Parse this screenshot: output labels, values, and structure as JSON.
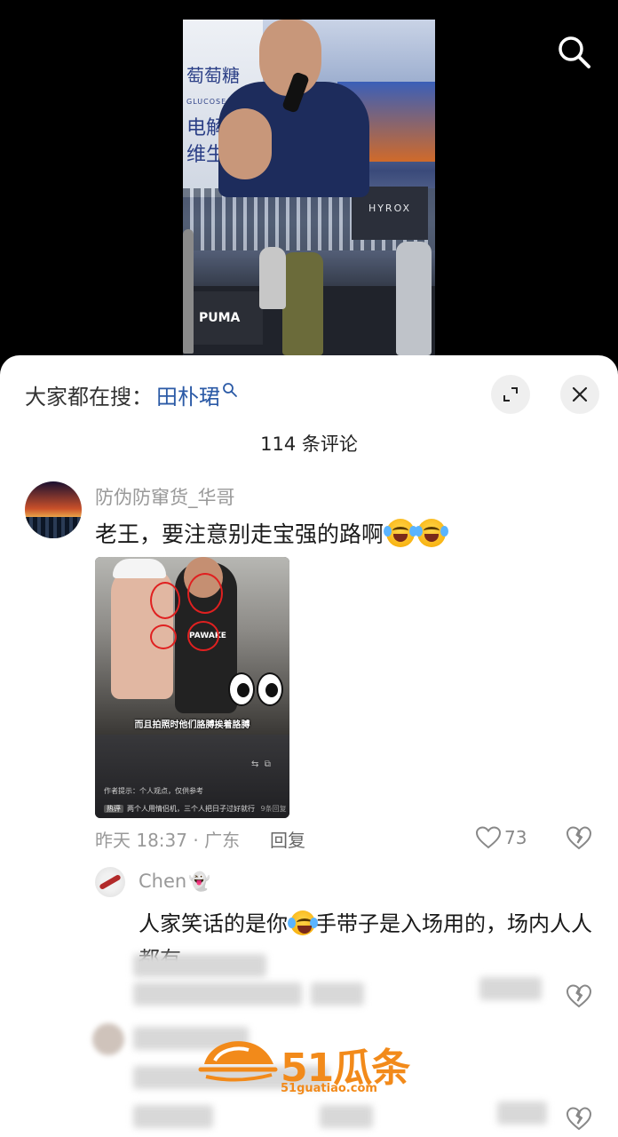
{
  "header": {
    "search_icon": "search-icon"
  },
  "video": {
    "banner_text": "萄萄糖\n电解质\n维生",
    "banner_sub": "GLUCOSE",
    "screen_text": "HYROX",
    "floor_brand": "PUMA"
  },
  "sheet": {
    "trending_prefix": "大家都在搜：",
    "trending_term": "田朴珺",
    "comment_count": "114 条评论",
    "expand_icon": "expand-icon",
    "close_icon": "close-icon"
  },
  "comments": [
    {
      "username": "防伪防窜货_华哥",
      "text": "老王，要注意别走宝强的路啊",
      "emojis": [
        "crying-laughing",
        "crying-laughing"
      ],
      "image": {
        "caption": "而且拍照时他们胳膊挨着胳膊",
        "shirt_text": "PAWAKE",
        "note": "作者提示：个人观点，仅供参考",
        "hot_tag": "热评",
        "hot_text": "两个人用情侣机，三个人把日子过好就行",
        "hot_suffix": "9条回复"
      },
      "meta": "昨天 18:37 · 广东",
      "reply_label": "回复",
      "likes": "73"
    },
    {
      "username": "Chen",
      "username_emoji": "👻",
      "text_part1": "人家笑话的是你",
      "text_part2": "手带子是入场用的，场内人人都有"
    }
  ],
  "watermark": {
    "name": "51瓜条",
    "url": "51guatiao.com"
  },
  "colors": {
    "link_blue": "#2b5aa6",
    "muted_gray": "#999999",
    "watermark_orange": "#f28a1a"
  }
}
